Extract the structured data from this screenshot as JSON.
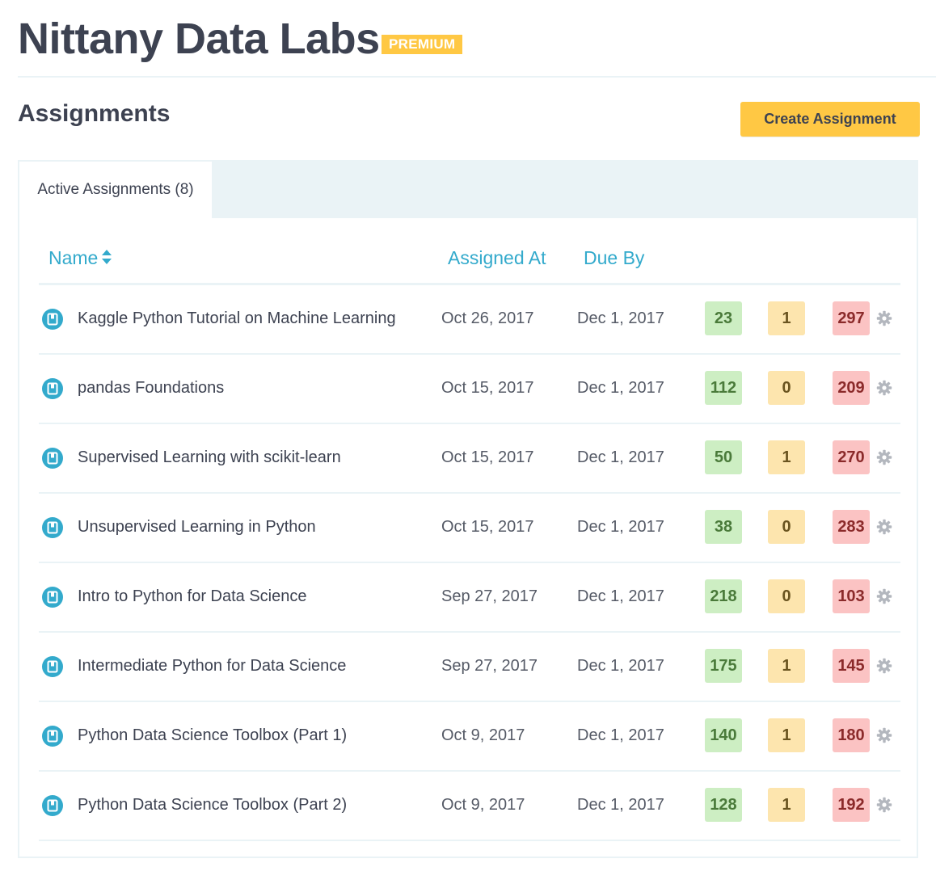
{
  "header": {
    "org_name": "Nittany Data Labs",
    "badge": "PREMIUM"
  },
  "page": {
    "title": "Assignments",
    "create_button_label": "Create Assignment"
  },
  "tabs": [
    {
      "label": "Active Assignments (8)",
      "active": true
    }
  ],
  "table": {
    "columns": {
      "name": "Name",
      "assigned_at": "Assigned At",
      "due_by": "Due By"
    },
    "rows": [
      {
        "name": "Kaggle Python Tutorial on Machine Learning",
        "assigned_at": "Oct 26, 2017",
        "due_by": "Dec 1, 2017",
        "green": "23",
        "yellow": "1",
        "red": "297"
      },
      {
        "name": "pandas Foundations",
        "assigned_at": "Oct 15, 2017",
        "due_by": "Dec 1, 2017",
        "green": "112",
        "yellow": "0",
        "red": "209"
      },
      {
        "name": "Supervised Learning with scikit-learn",
        "assigned_at": "Oct 15, 2017",
        "due_by": "Dec 1, 2017",
        "green": "50",
        "yellow": "1",
        "red": "270"
      },
      {
        "name": "Unsupervised Learning in Python",
        "assigned_at": "Oct 15, 2017",
        "due_by": "Dec 1, 2017",
        "green": "38",
        "yellow": "0",
        "red": "283"
      },
      {
        "name": "Intro to Python for Data Science",
        "assigned_at": "Sep 27, 2017",
        "due_by": "Dec 1, 2017",
        "green": "218",
        "yellow": "0",
        "red": "103"
      },
      {
        "name": "Intermediate Python for Data Science",
        "assigned_at": "Sep 27, 2017",
        "due_by": "Dec 1, 2017",
        "green": "175",
        "yellow": "1",
        "red": "145"
      },
      {
        "name": "Python Data Science Toolbox (Part 1)",
        "assigned_at": "Oct 9, 2017",
        "due_by": "Dec 1, 2017",
        "green": "140",
        "yellow": "1",
        "red": "180"
      },
      {
        "name": "Python Data Science Toolbox (Part 2)",
        "assigned_at": "Oct 9, 2017",
        "due_by": "Dec 1, 2017",
        "green": "128",
        "yellow": "1",
        "red": "192"
      }
    ]
  },
  "icons": {
    "row_icon": "course-book-icon",
    "row_action": "gear-icon",
    "sort": "sort-icon"
  },
  "colors": {
    "accent": "#33aacc",
    "brand_yellow": "#ffc844",
    "green_pill": "#cdeec3",
    "yellow_pill": "#fde5ae",
    "red_pill": "#fbc3c3"
  }
}
